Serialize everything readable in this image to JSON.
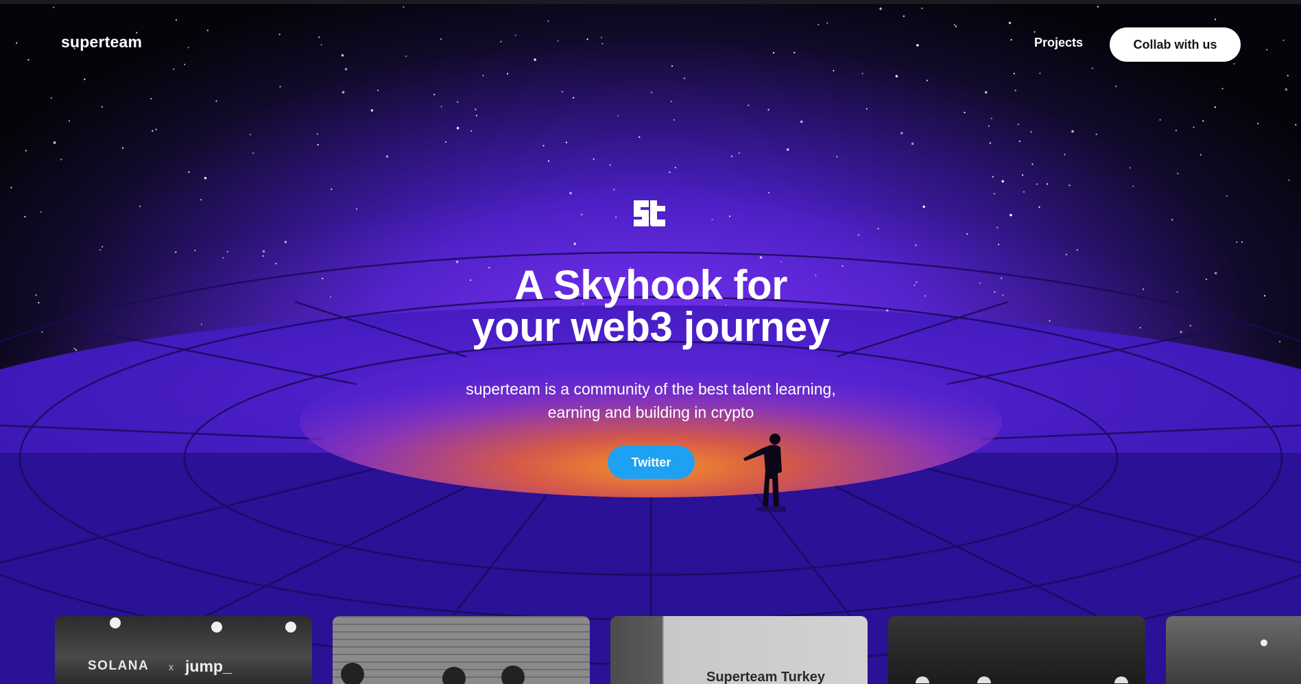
{
  "header": {
    "brand": "superteam",
    "nav": {
      "projects_label": "Projects",
      "collab_label": "Collab with us"
    }
  },
  "hero": {
    "logo_icon": "superteam-st-logo-icon",
    "headline_line1": "A Skyhook for",
    "headline_line2": "your web3 journey",
    "description_line1": "superteam is a community of the best talent learning,",
    "description_line2": "earning and building in crypto",
    "cta_label": "Twitter",
    "cta_color": "#1ea1f2"
  },
  "gallery": {
    "cards": [
      {
        "caption_left": "SOLANA",
        "caption_mid": "x",
        "caption_right": "jump_"
      },
      {
        "caption": ""
      },
      {
        "caption": "Superteam Turkey"
      },
      {
        "caption": ""
      },
      {
        "caption": ""
      }
    ]
  },
  "colors": {
    "background_dark": "#05040a",
    "purple_glow": "#6a2be8",
    "horizon_orange": "#f08a2a",
    "button_white": "#ffffff"
  }
}
